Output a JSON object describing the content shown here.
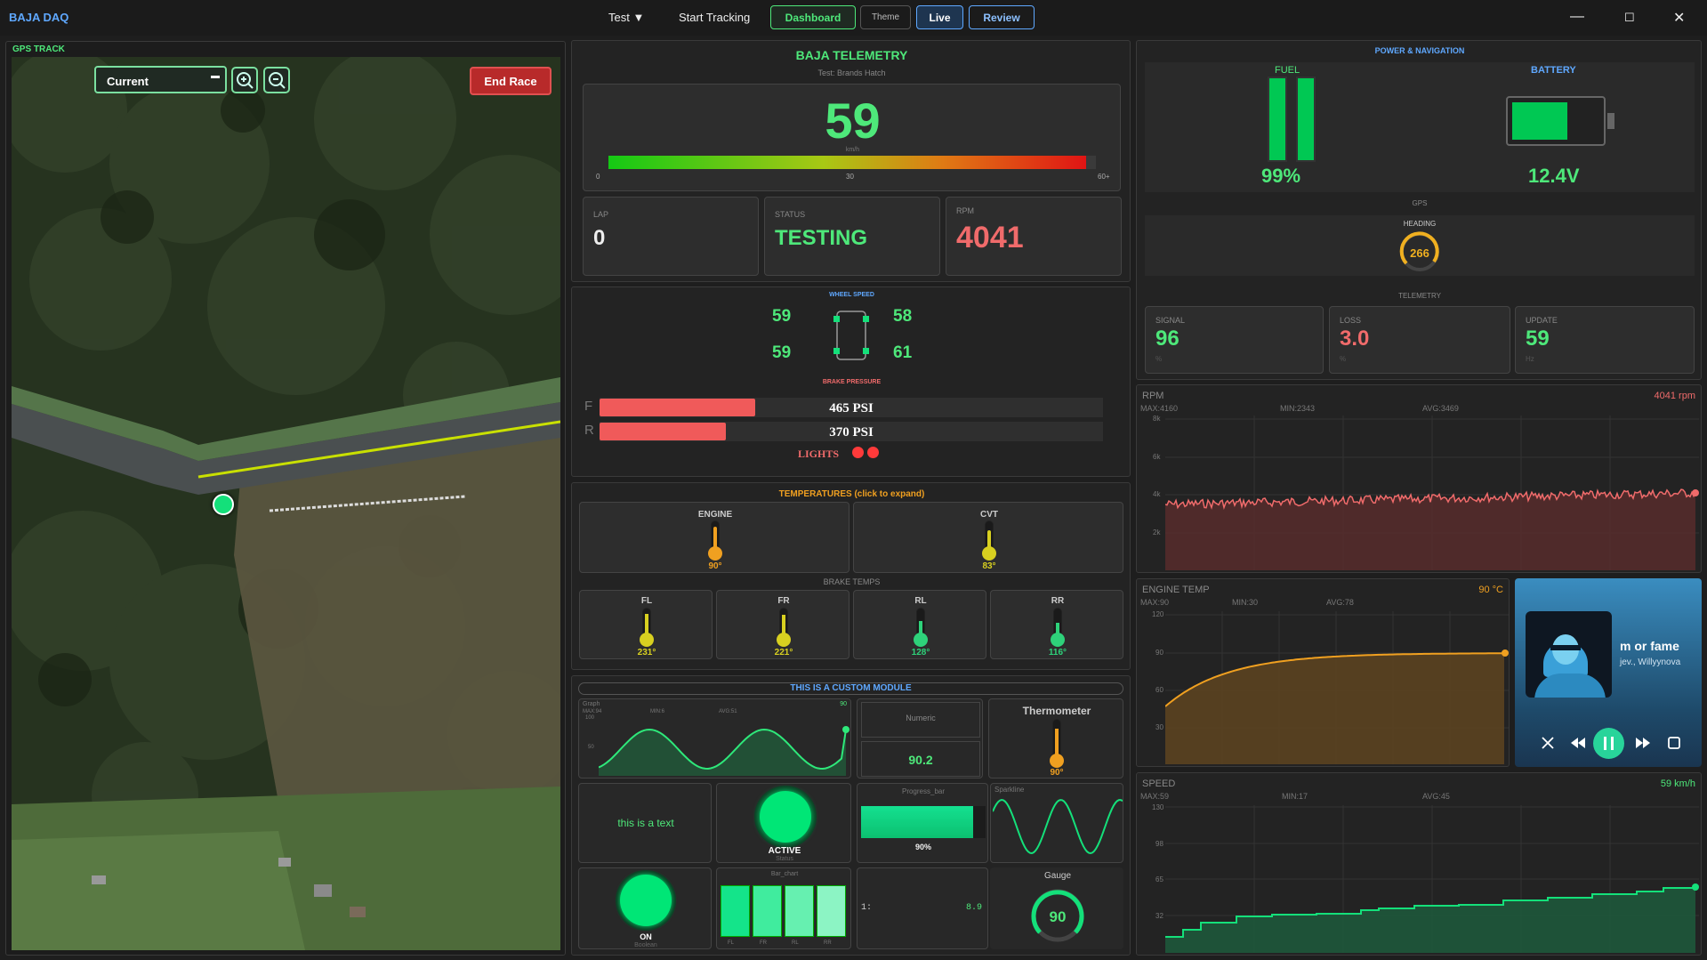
{
  "app": {
    "title": "BAJA DAQ"
  },
  "menu": {
    "test_label": "Test ▼",
    "start_tracking": "Start Tracking"
  },
  "toolbar": {
    "dashboard": "Dashboard",
    "theme": "Theme",
    "live": "Live",
    "review": "Review"
  },
  "window": {
    "minimize": "—",
    "maximize": "☐",
    "close": "✕"
  },
  "gps_panel": {
    "title": "GPS TRACK",
    "view_select": "Current",
    "view_select_caret": "▬",
    "end_race": "End Race"
  },
  "telemetry": {
    "title": "BAJA TELEMETRY",
    "subtitle": "Test: Brands Hatch",
    "speed": "59",
    "speed_unit": "km/h",
    "speed_min": "0",
    "speed_mid": "30",
    "speed_max": "60+",
    "speed_fraction": 0.98,
    "lap_label": "LAP",
    "lap_value": "0",
    "status_label": "STATUS",
    "status_value": "TESTING",
    "rpm_label": "RPM",
    "rpm_value": "4041"
  },
  "wheel_speed": {
    "title": "WHEEL SPEED",
    "fl": "59",
    "fr": "58",
    "rl": "59",
    "rr": "61"
  },
  "brake_pressure": {
    "title": "BRAKE PRESSURE",
    "front_label": "F",
    "front_value": "465 PSI",
    "front_fraction": 0.31,
    "rear_label": "R",
    "rear_value": "370 PSI",
    "rear_fraction": 0.25,
    "lights_label": "LIGHTS"
  },
  "temperatures": {
    "title": "TEMPERATURES (click to expand)",
    "engine_label": "ENGINE",
    "engine_value": "90°",
    "engine_level": 0.5,
    "cvt_label": "CVT",
    "cvt_value": "83°",
    "cvt_level": 0.45,
    "brake_title": "BRAKE TEMPS",
    "fl_label": "FL",
    "fl_value": "231°",
    "fr_label": "FR",
    "fr_value": "221°",
    "rl_label": "RL",
    "rl_value": "128°",
    "rr_label": "RR",
    "rr_value": "116°"
  },
  "custom_module": {
    "title": "THIS IS A CUSTOM MODULE",
    "graph_label": "Graph",
    "graph_value": "90",
    "graph_max": "MAX:94",
    "graph_min": "MIN:6",
    "graph_avg": "AVG:51",
    "graph_tick_hi": "100",
    "graph_tick_lo": "50",
    "numeric_label": "Numeric",
    "numeric_value": "90.2",
    "thermometer_label": "Thermometer",
    "thermometer_value": "90°",
    "text_value": "this is a text",
    "status_value": "ACTIVE",
    "status_label": "Status",
    "progress_label": "Progress_bar",
    "progress_value": "90%",
    "progress_fraction": 0.9,
    "sparkline_label": "Sparkline",
    "boolean_value": "ON",
    "boolean_label": "Boolean",
    "bar_chart_label": "Bar_chart",
    "bar_categories": [
      "FL",
      "FR",
      "RL",
      "RR"
    ],
    "list_key": "1:",
    "list_value": "8.9",
    "gauge_label": "Gauge",
    "gauge_value": "90"
  },
  "power": {
    "title": "POWER & NAVIGATION",
    "fuel_label": "FUEL",
    "fuel_value": "99%",
    "battery_label": "BATTERY",
    "battery_value": "12.4V",
    "gps_label": "GPS",
    "heading_label": "HEADING",
    "heading_value": "266",
    "telemetry_label": "TELEMETRY",
    "signal_label": "SIGNAL",
    "signal_value": "96",
    "signal_unit": "%",
    "loss_label": "LOSS",
    "loss_value": "3.0",
    "loss_unit": "%",
    "update_label": "UPDATE",
    "update_value": "59",
    "update_unit": "Hz"
  },
  "rpm_chart": {
    "title": "RPM",
    "current": "4041 rpm",
    "max": "MAX:4160",
    "min": "MIN:2343",
    "avg": "AVG:3469",
    "ticks": [
      "8k",
      "6k",
      "4k",
      "2k"
    ]
  },
  "engine_temp_chart": {
    "title": "ENGINE TEMP",
    "current": "90 °C",
    "max": "MAX:90",
    "min": "MIN:30",
    "avg": "AVG:78",
    "ticks": [
      "120",
      "90",
      "60",
      "30"
    ]
  },
  "speed_chart": {
    "title": "SPEED",
    "current": "59 km/h",
    "max": "MAX:59",
    "min": "MIN:17",
    "avg": "AVG:45",
    "ticks": [
      "130",
      "98",
      "65",
      "32"
    ]
  },
  "media": {
    "title": "m or fame",
    "artist": "jev., Willyynova"
  },
  "colors": {
    "accent": "#00e676",
    "danger": "#ff5252",
    "warning": "#ffa726",
    "brand": "#5fa8ff"
  }
}
